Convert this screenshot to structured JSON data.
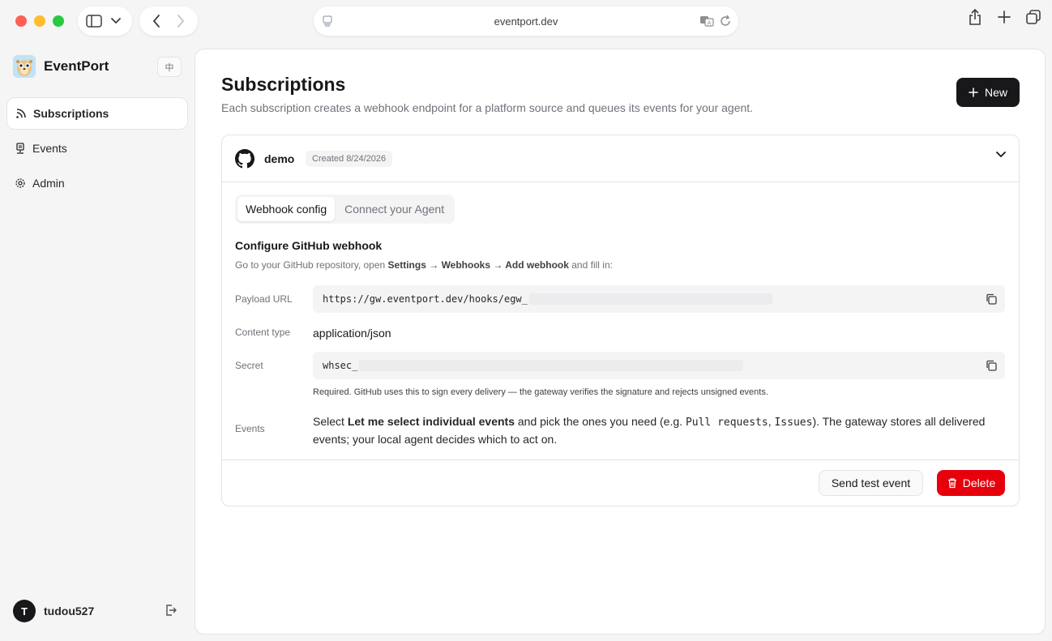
{
  "browser": {
    "url": "eventport.dev"
  },
  "brand": {
    "name": "EventPort",
    "lang_label": "中"
  },
  "sidebar": {
    "items": [
      {
        "label": "Subscriptions",
        "icon": "rss-icon",
        "active": true
      },
      {
        "label": "Events",
        "icon": "events-icon",
        "active": false
      },
      {
        "label": "Admin",
        "icon": "gear-icon",
        "active": false
      }
    ]
  },
  "user": {
    "initial": "T",
    "name": "tudou527"
  },
  "page": {
    "title": "Subscriptions",
    "subtitle": "Each subscription creates a webhook endpoint for a platform source and queues its events for your agent.",
    "new_button": "New"
  },
  "subscription": {
    "name": "demo",
    "created": "Created 8/24/2026",
    "tabs": [
      "Webhook config",
      "Connect your Agent"
    ],
    "config_title": "Configure GitHub webhook",
    "config_desc_prefix": "Go to your GitHub repository, open ",
    "config_desc_settings": "Settings",
    "config_desc_arrow": " → ",
    "config_desc_webhooks": "Webhooks",
    "config_desc_add": "Add webhook",
    "config_desc_suffix": " and fill in:",
    "fields": {
      "payload_label": "Payload URL",
      "payload_value": "https://gw.eventport.dev/hooks/egw_",
      "content_type_label": "Content type",
      "content_type_value": "application/json",
      "secret_label": "Secret",
      "secret_value": "whsec_",
      "secret_hint": "Required. GitHub uses this to sign every delivery — the gateway verifies the signature and rejects unsigned events.",
      "events_label": "Events",
      "events_pre": "Select ",
      "events_bold": "Let me select individual events",
      "events_mid": " and pick the ones you need (e.g. ",
      "events_code1": "Pull requests",
      "events_comma": ", ",
      "events_code2": "Issues",
      "events_post": "). The gateway stores all delivered events; your local agent decides which to act on."
    },
    "send_test_button": "Send test event",
    "delete_button": "Delete"
  },
  "colors": {
    "accent_dark": "#18181b",
    "danger": "#e7000b"
  }
}
